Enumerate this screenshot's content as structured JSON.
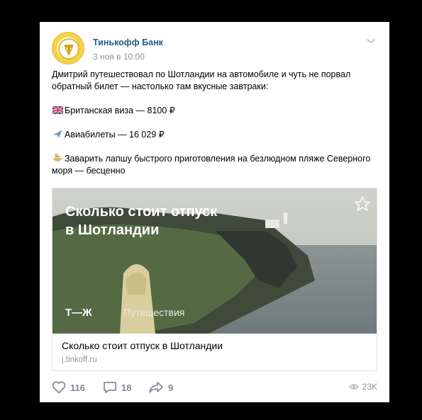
{
  "post": {
    "author": "Тинькофф Банк",
    "date": "3 ноя в 10:00",
    "intro_line1": "Дмитрий путешествовал по Шотландии на автомобиле и чуть не порвал",
    "intro_line2": "обратный билет — настолько там вкусные завтраки:",
    "items": [
      {
        "icon": "uk-flag-icon",
        "text": "Британская виза — 8100 ₽"
      },
      {
        "icon": "airplane-icon",
        "text": "Авиабилеты — 16 029 ₽"
      },
      {
        "icon": "noodle-bowl-icon",
        "text_line1": "Заварить лапшу быстрого приготовления на безлюдном пляже Северного",
        "text_line2": "моря — бесценно"
      }
    ]
  },
  "attachment": {
    "image_headline_line1": "Сколько стоит отпуск",
    "image_headline_line2": "в Шотландии",
    "brand_mark": "Т—Ж",
    "brand_label": "Путешествия",
    "title": "Сколько стоит отпуск в Шотландии",
    "domain": "j.tinkoff.ru"
  },
  "footer": {
    "likes": "116",
    "comments": "18",
    "shares": "9",
    "views": "23K"
  },
  "colors": {
    "link": "#2a5885",
    "muted": "#939393",
    "icon": "#828a99",
    "brand_yellow": "#f3d24a"
  }
}
